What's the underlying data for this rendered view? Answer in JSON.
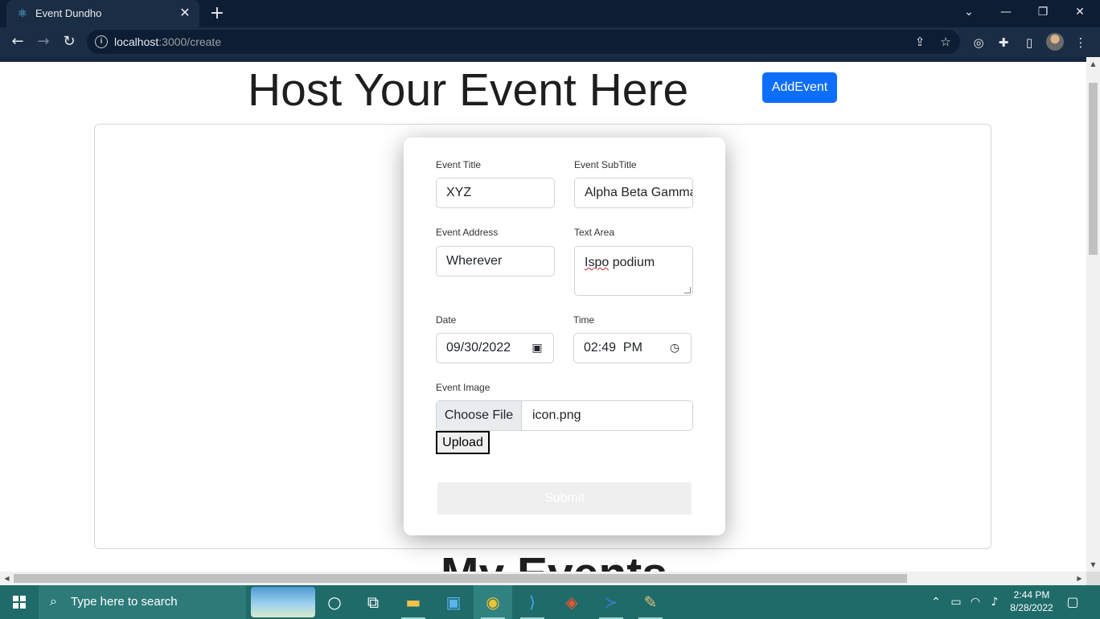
{
  "browser": {
    "tab_title": "Event Dundho",
    "tab_close": "✕",
    "new_tab": "+",
    "url_host": "localhost",
    "url_rest": ":3000/create",
    "icons": [
      "back-icon",
      "forward-icon",
      "reload-icon",
      "info-icon",
      "share-icon",
      "star-icon",
      "extension-icon",
      "sidebar-icon",
      "menu-icon"
    ]
  },
  "page": {
    "title": "Host Your Event Here",
    "add_event_label": "AddEvent",
    "section_title": "My Events",
    "accent": "#0d6efd"
  },
  "form": {
    "title_label": "Event Title",
    "title_value": "XYZ",
    "subtitle_label": "Event SubTitle",
    "subtitle_value": "Alpha Beta Gamma",
    "address_label": "Event Address",
    "address_value": "Wherever",
    "textarea_label": "Text Area",
    "textarea_word1": "Ispo",
    "textarea_word2": " podium",
    "date_label": "Date",
    "date_value": "09/30/2022",
    "time_label": "Time",
    "time_value": "02:49  PM",
    "image_label": "Event Image",
    "choose_file_label": "Choose File",
    "file_name": "icon.png",
    "upload_label": "Upload",
    "submit_label": "Submit"
  },
  "taskbar": {
    "search_placeholder": "Type here to search",
    "time": "2:44 PM",
    "date": "8/28/2022"
  }
}
